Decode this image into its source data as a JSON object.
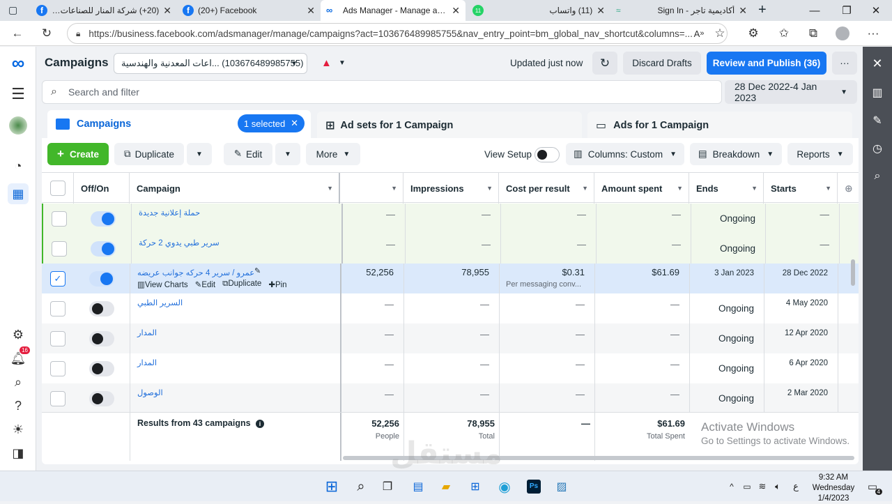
{
  "browser": {
    "tabs": [
      {
        "title": "(20+) شركة المنار للصناعات الـ",
        "icon": "facebook-icon"
      },
      {
        "title": "(20+) Facebook",
        "icon": "facebook-icon"
      },
      {
        "title": "Ads Manager - Manage ads -",
        "icon": "meta-icon"
      },
      {
        "title": "(11) واتساب",
        "icon": "whatsapp-icon",
        "badge": "11"
      },
      {
        "title": "أكاديمية تاجر - Sign In",
        "icon": "site-icon"
      }
    ],
    "url": "https://business.facebook.com/adsmanager/manage/campaigns?act=103676489985755&nav_entry_point=bm_global_nav_shortcut&columns=..."
  },
  "header": {
    "title": "Campaigns",
    "account": "(103676489985755) ...اعات المعدنية والهندسية",
    "updated": "Updated just now",
    "discard": "Discard Drafts",
    "publish": "Review and Publish (36)",
    "more": "···"
  },
  "search": {
    "placeholder": "Search and filter",
    "date_range": "28 Dec 2022-4 Jan 2023"
  },
  "tabs": {
    "campaigns": "Campaigns",
    "selected": "1 selected",
    "adsets": "Ad sets for 1 Campaign",
    "ads": "Ads for 1 Campaign"
  },
  "toolbar": {
    "create": "Create",
    "duplicate": "Duplicate",
    "edit": "Edit",
    "more": "More",
    "view_setup": "View Setup",
    "columns": "Columns: Custom",
    "breakdown": "Breakdown",
    "reports": "Reports"
  },
  "table": {
    "headers": {
      "offon": "Off/On",
      "campaign": "Campaign",
      "impressions": "Impressions",
      "cpr": "Cost per result",
      "spent": "Amount spent",
      "ends": "Ends",
      "starts": "Starts"
    },
    "rows": [
      {
        "name": "حملة إعلانية جديدة",
        "results": "—",
        "impressions": "—",
        "cpr": "—",
        "spent": "—",
        "ends": "Ongoing",
        "starts": "—",
        "on": true,
        "checked": false
      },
      {
        "name": "سرير طبي يدوي 2 حركة",
        "results": "—",
        "impressions": "—",
        "cpr": "—",
        "spent": "—",
        "ends": "Ongoing",
        "starts": "—",
        "on": true,
        "checked": false
      },
      {
        "name": "عمرو / سرير 4 حركه جوانب عريضه",
        "results": "52,256",
        "impressions": "78,955",
        "cpr": "$0.31",
        "cpr_sub": "Per messaging conv...",
        "spent": "$61.69",
        "ends": "3 Jan 2023",
        "starts": "28 Dec 2022",
        "on": true,
        "checked": true
      },
      {
        "name": "السرير الطبي",
        "results": "—",
        "impressions": "—",
        "cpr": "—",
        "spent": "—",
        "ends": "Ongoing",
        "starts": "4 May 2020",
        "on": false,
        "checked": false
      },
      {
        "name": "المدار",
        "results": "—",
        "impressions": "—",
        "cpr": "—",
        "spent": "—",
        "ends": "Ongoing",
        "starts": "12 Apr 2020",
        "on": false,
        "checked": false
      },
      {
        "name": "المدار",
        "results": "—",
        "impressions": "—",
        "cpr": "—",
        "spent": "—",
        "ends": "Ongoing",
        "starts": "6 Apr 2020",
        "on": false,
        "checked": false
      },
      {
        "name": "الوصول",
        "results": "—",
        "impressions": "—",
        "cpr": "—",
        "spent": "—",
        "ends": "Ongoing",
        "starts": "2 Mar 2020",
        "on": false,
        "checked": false
      }
    ],
    "row_actions": {
      "charts": "View Charts",
      "edit": "Edit",
      "duplicate": "Duplicate",
      "pin": "Pin"
    },
    "footer": {
      "label": "Results from 43 campaigns",
      "results": "52,256",
      "results_sub": "People",
      "impressions": "78,955",
      "impressions_sub": "Total",
      "cpr": "—",
      "spent": "$61.69",
      "spent_sub": "Total Spent"
    }
  },
  "rail": {
    "notif_count": "16"
  },
  "windows": {
    "activate_title": "Activate Windows",
    "activate_sub": "Go to Settings to activate Windows.",
    "time": "9:32 AM",
    "day": "Wednesday",
    "date": "1/4/2023",
    "lang": "ع",
    "notif": "4"
  },
  "watermark": "مستقل",
  "colors": {
    "accent": "#1877f2",
    "green": "#42b72a",
    "selected_row": "#dbe9fb",
    "highlight_row": "#f1f8ec"
  }
}
